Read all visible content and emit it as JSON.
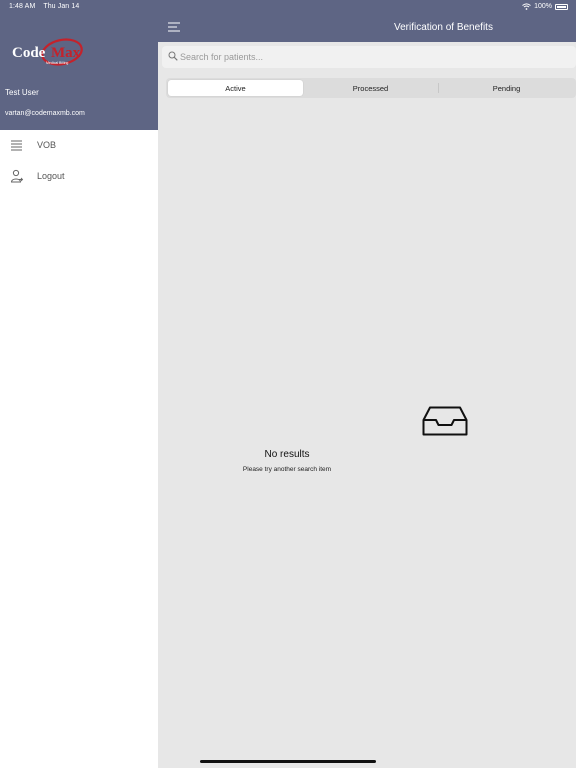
{
  "status_bar": {
    "time": "1:48 AM",
    "date": "Thu Jan 14",
    "battery": "100%"
  },
  "sidebar": {
    "logo_text": "CodeMax",
    "logo_subtext": "Medical Billing",
    "user_name": "Test User",
    "user_email": "vartan@codemaxmb.com",
    "items": [
      {
        "label": "VOB",
        "icon": "list-icon"
      },
      {
        "label": "Logout",
        "icon": "user-icon"
      }
    ]
  },
  "header": {
    "title": "Verification of Benefits"
  },
  "search": {
    "placeholder": "Search for patients..."
  },
  "tabs": [
    {
      "label": "Active",
      "selected": true
    },
    {
      "label": "Processed",
      "selected": false
    },
    {
      "label": "Pending",
      "selected": false
    }
  ],
  "empty_state": {
    "title": "No results",
    "subtitle": "Please try another search item",
    "icon": "inbox-tray-icon"
  },
  "colors": {
    "header_bg": "#5e6584",
    "logo_red": "#c4222b",
    "content_bg": "#e7e7e7"
  }
}
